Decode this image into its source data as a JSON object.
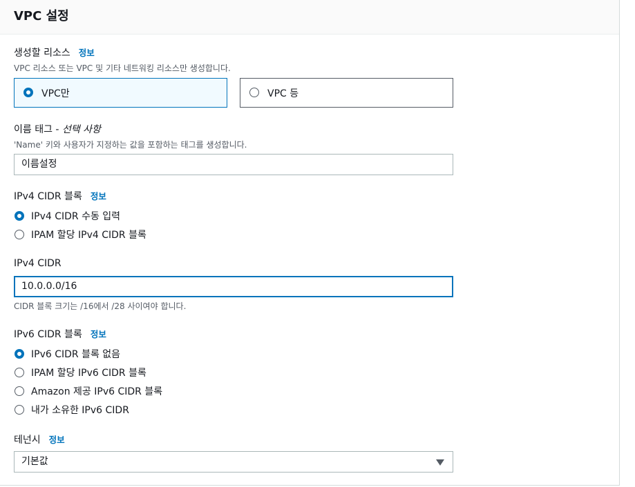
{
  "section": {
    "title": "VPC 설정"
  },
  "resources": {
    "label": "생성할 리소스",
    "info": "정보",
    "description": "VPC 리소스 또는 VPC 및 기타 네트워킹 리소스만 생성합니다.",
    "options": [
      {
        "label": "VPC만",
        "selected": true
      },
      {
        "label": "VPC 등",
        "selected": false
      }
    ]
  },
  "name_tag": {
    "label": "이름 태그 - ",
    "optional": "선택 사항",
    "description": "'Name' 키와 사용자가 지정하는 값을 포함하는 태그를 생성합니다.",
    "value": "이름설정"
  },
  "ipv4_block": {
    "label": "IPv4 CIDR 블록",
    "info": "정보",
    "options": [
      {
        "label": "IPv4 CIDR 수동 입력",
        "selected": true
      },
      {
        "label": "IPAM 할당 IPv4 CIDR 블록",
        "selected": false
      }
    ]
  },
  "ipv4_cidr": {
    "label": "IPv4 CIDR",
    "value": "10.0.0.0/16",
    "hint": "CIDR 블록 크기는 /16에서 /28 사이여야 합니다."
  },
  "ipv6_block": {
    "label": "IPv6 CIDR 블록",
    "info": "정보",
    "options": [
      {
        "label": "IPv6 CIDR 블록 없음",
        "selected": true
      },
      {
        "label": "IPAM 할당 IPv6 CIDR 블록",
        "selected": false
      },
      {
        "label": "Amazon 제공 IPv6 CIDR 블록",
        "selected": false
      },
      {
        "label": "내가 소유한 IPv6 CIDR",
        "selected": false
      }
    ]
  },
  "tenancy": {
    "label": "테넌시",
    "info": "정보",
    "value": "기본값"
  },
  "colors": {
    "accent": "#0073bb",
    "text": "#16191f",
    "muted": "#545b64"
  }
}
